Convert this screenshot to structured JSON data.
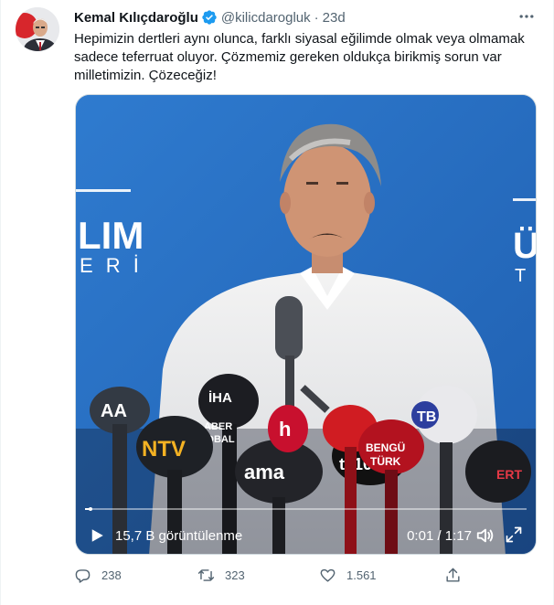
{
  "tweet": {
    "author_name": "Kemal Kılıçdaroğlu",
    "handle": "@kilicdarogluk",
    "separator": "·",
    "time": "23d",
    "text": "Hepimizin dertleri aynı olunca, farklı siyasal eğilimde olmak veya olmamak sadece teferruat oluyor. Çözmemiz gereken oldukça birikmiş sorun var milletimizin. Çözeceğiz!"
  },
  "video": {
    "views_label": "15,7 B görüntülenme",
    "timecode": "0:01 / 1:17",
    "progress": 0.013,
    "backdrop_left_text_1": "LIM",
    "backdrop_left_text_2": "E R İ",
    "backdrop_right_text_1": "Ü",
    "backdrop_right_text_2": "T",
    "mic_labels": [
      "AA",
      "İHA",
      "ABER",
      "DBAL",
      "NTV",
      "ama",
      "tv100",
      "h",
      "BENGÜ",
      "TÜRK",
      "TB",
      "ERT"
    ]
  },
  "actions": {
    "reply_count": "238",
    "retweet_count": "323",
    "like_count": "1.561"
  },
  "colors": {
    "verified": "#1d9bf0",
    "text_secondary": "#536471",
    "backdrop_blue": "#2b72c6"
  }
}
